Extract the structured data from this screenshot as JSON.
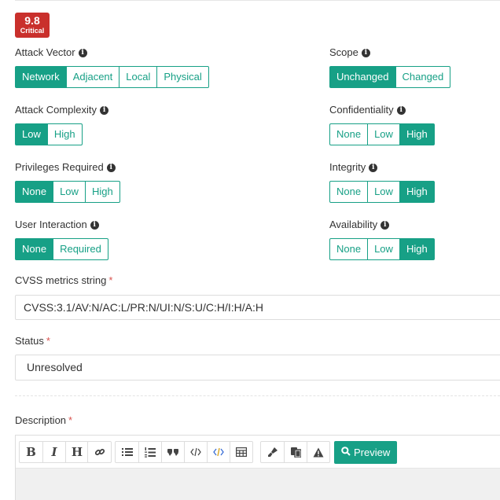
{
  "score": {
    "value": "9.8",
    "severity": "Critical",
    "color": "#c9302c"
  },
  "accent_color": "#17a086",
  "metrics_left": [
    {
      "label": "Attack Vector",
      "options": [
        "Network",
        "Adjacent",
        "Local",
        "Physical"
      ],
      "selected": "Network"
    },
    {
      "label": "Attack Complexity",
      "options": [
        "Low",
        "High"
      ],
      "selected": "Low"
    },
    {
      "label": "Privileges Required",
      "options": [
        "None",
        "Low",
        "High"
      ],
      "selected": "None"
    },
    {
      "label": "User Interaction",
      "options": [
        "None",
        "Required"
      ],
      "selected": "None"
    }
  ],
  "metrics_right": [
    {
      "label": "Scope",
      "options": [
        "Unchanged",
        "Changed"
      ],
      "selected": "Unchanged"
    },
    {
      "label": "Confidentiality",
      "options": [
        "None",
        "Low",
        "High"
      ],
      "selected": "High"
    },
    {
      "label": "Integrity",
      "options": [
        "None",
        "Low",
        "High"
      ],
      "selected": "High"
    },
    {
      "label": "Availability",
      "options": [
        "None",
        "Low",
        "High"
      ],
      "selected": "High"
    }
  ],
  "cvss_string": {
    "label": "CVSS metrics string",
    "required_mark": "*",
    "value": "CVSS:3.1/AV:N/AC:L/PR:N/UI:N/S:U/C:H/I:H/A:H"
  },
  "status": {
    "label": "Status",
    "required_mark": "*",
    "value": "Unresolved"
  },
  "description": {
    "label": "Description",
    "required_mark": "*",
    "toolbar": {
      "bold": "B",
      "italic": "I",
      "heading": "H",
      "icons": [
        "link-icon",
        "unordered-list-icon",
        "ordered-list-icon",
        "quote-icon",
        "code-icon",
        "code-block-icon",
        "table-icon",
        "clean-block-icon",
        "paste-icon",
        "warning-icon"
      ],
      "preview_label": "Preview"
    }
  }
}
